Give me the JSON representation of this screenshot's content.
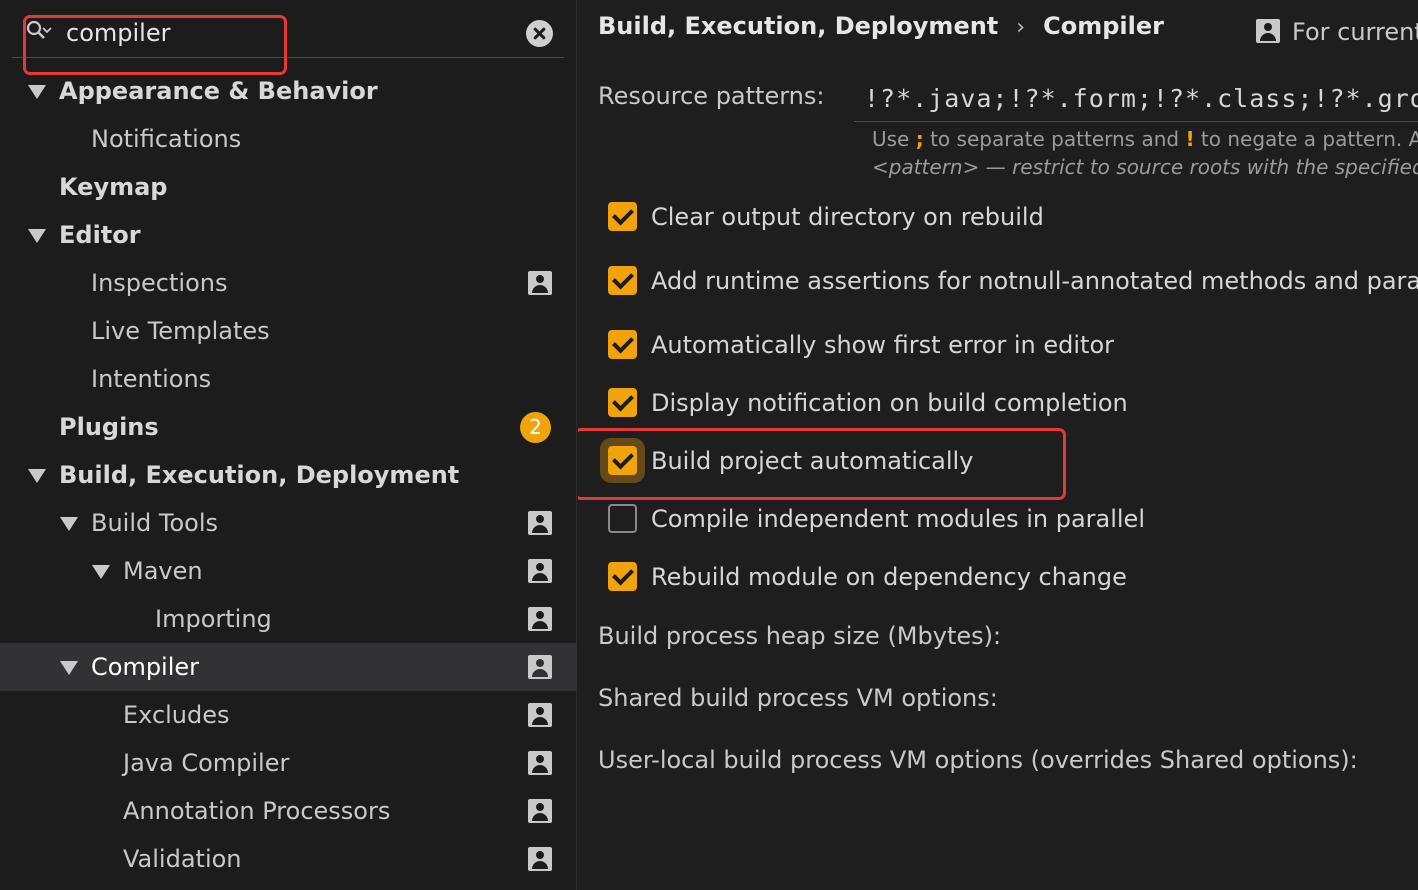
{
  "search": {
    "value": "compiler"
  },
  "tree": [
    {
      "label": "Appearance & Behavior",
      "bold": true,
      "indent": 0,
      "arrow": true
    },
    {
      "label": "Notifications",
      "indent": 1
    },
    {
      "label": "Keymap",
      "bold": true,
      "indent": 0
    },
    {
      "label": "Editor",
      "bold": true,
      "indent": 0,
      "arrow": true
    },
    {
      "label": "Inspections",
      "indent": 1,
      "profile": true
    },
    {
      "label": "Live Templates",
      "indent": 1
    },
    {
      "label": "Intentions",
      "indent": 1
    },
    {
      "label": "Plugins",
      "bold": true,
      "indent": 0,
      "badge": "2"
    },
    {
      "label": "Build, Execution, Deployment",
      "bold": true,
      "indent": 0,
      "arrow": true
    },
    {
      "label": "Build Tools",
      "indent": 1,
      "arrow": true,
      "profile": true
    },
    {
      "label": "Maven",
      "indent": 2,
      "arrow": true,
      "profile": true
    },
    {
      "label": "Importing",
      "indent": 3,
      "profile": true
    },
    {
      "label": "Compiler",
      "indent": 1,
      "arrow": true,
      "profile": true,
      "selected": true
    },
    {
      "label": "Excludes",
      "indent": 2,
      "profile": true
    },
    {
      "label": "Java Compiler",
      "indent": 2,
      "profile": true
    },
    {
      "label": "Annotation Processors",
      "indent": 2,
      "profile": true
    },
    {
      "label": "Validation",
      "indent": 2,
      "profile": true
    }
  ],
  "breadcrumb": {
    "parent": "Build, Execution, Deployment",
    "separator": "›",
    "current": "Compiler"
  },
  "for_current": "For current project",
  "resource": {
    "label": "Resource patterns:",
    "value": "!?*.java;!?*.form;!?*.class;!?*.groovy;!?*.scala;!?*.flex;!?*.kt;!?*.clj;!?*.aj",
    "hint1_a": "Use ",
    "hint1_sep": ";",
    "hint1_b": " to separate patterns and ",
    "hint1_neg": "!",
    "hint1_c": " to negate a pattern. Accepted wildcards: ? — exactly one symbol",
    "hint2": "<pattern> — restrict to source roots with the specified type"
  },
  "checkboxes": [
    {
      "label": "Clear output directory on rebuild",
      "checked": true
    },
    {
      "label": "Add runtime assertions for notnull-annotated methods and parameters",
      "checked": true
    },
    {
      "label": "Automatically show first error in editor",
      "checked": true
    },
    {
      "label": "Display notification on build completion",
      "checked": true
    },
    {
      "label": "Build project automatically",
      "checked": true,
      "focused": true
    },
    {
      "label": "Compile independent modules in parallel",
      "checked": false
    },
    {
      "label": "Rebuild module on dependency change",
      "checked": true
    }
  ],
  "fields": {
    "heap_size": "Build process heap size (Mbytes):",
    "shared_vm": "Shared build process VM options:",
    "user_vm": "User-local build process VM options (overrides Shared options):"
  },
  "colors": {
    "accent": "#f0a30a",
    "highlight": "#e53935",
    "background": "#1e1e1f"
  }
}
